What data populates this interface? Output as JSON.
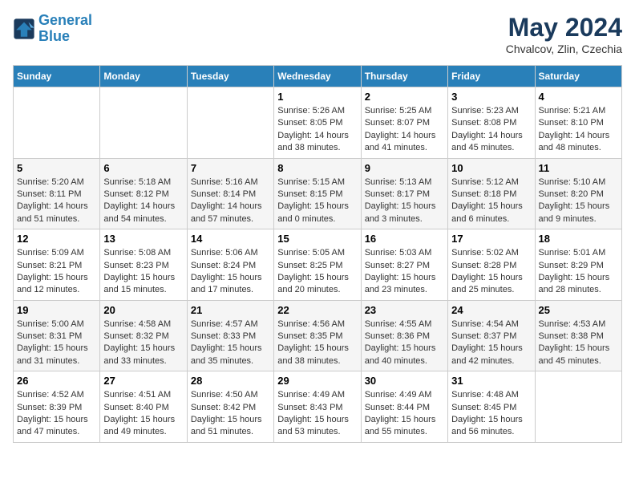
{
  "header": {
    "logo_line1": "General",
    "logo_line2": "Blue",
    "month_title": "May 2024",
    "location": "Chvalcov, Zlin, Czechia"
  },
  "weekdays": [
    "Sunday",
    "Monday",
    "Tuesday",
    "Wednesday",
    "Thursday",
    "Friday",
    "Saturday"
  ],
  "weeks": [
    [
      {
        "day": "",
        "content": ""
      },
      {
        "day": "",
        "content": ""
      },
      {
        "day": "",
        "content": ""
      },
      {
        "day": "1",
        "content": "Sunrise: 5:26 AM\nSunset: 8:05 PM\nDaylight: 14 hours and 38 minutes."
      },
      {
        "day": "2",
        "content": "Sunrise: 5:25 AM\nSunset: 8:07 PM\nDaylight: 14 hours and 41 minutes."
      },
      {
        "day": "3",
        "content": "Sunrise: 5:23 AM\nSunset: 8:08 PM\nDaylight: 14 hours and 45 minutes."
      },
      {
        "day": "4",
        "content": "Sunrise: 5:21 AM\nSunset: 8:10 PM\nDaylight: 14 hours and 48 minutes."
      }
    ],
    [
      {
        "day": "5",
        "content": "Sunrise: 5:20 AM\nSunset: 8:11 PM\nDaylight: 14 hours and 51 minutes."
      },
      {
        "day": "6",
        "content": "Sunrise: 5:18 AM\nSunset: 8:12 PM\nDaylight: 14 hours and 54 minutes."
      },
      {
        "day": "7",
        "content": "Sunrise: 5:16 AM\nSunset: 8:14 PM\nDaylight: 14 hours and 57 minutes."
      },
      {
        "day": "8",
        "content": "Sunrise: 5:15 AM\nSunset: 8:15 PM\nDaylight: 15 hours and 0 minutes."
      },
      {
        "day": "9",
        "content": "Sunrise: 5:13 AM\nSunset: 8:17 PM\nDaylight: 15 hours and 3 minutes."
      },
      {
        "day": "10",
        "content": "Sunrise: 5:12 AM\nSunset: 8:18 PM\nDaylight: 15 hours and 6 minutes."
      },
      {
        "day": "11",
        "content": "Sunrise: 5:10 AM\nSunset: 8:20 PM\nDaylight: 15 hours and 9 minutes."
      }
    ],
    [
      {
        "day": "12",
        "content": "Sunrise: 5:09 AM\nSunset: 8:21 PM\nDaylight: 15 hours and 12 minutes."
      },
      {
        "day": "13",
        "content": "Sunrise: 5:08 AM\nSunset: 8:23 PM\nDaylight: 15 hours and 15 minutes."
      },
      {
        "day": "14",
        "content": "Sunrise: 5:06 AM\nSunset: 8:24 PM\nDaylight: 15 hours and 17 minutes."
      },
      {
        "day": "15",
        "content": "Sunrise: 5:05 AM\nSunset: 8:25 PM\nDaylight: 15 hours and 20 minutes."
      },
      {
        "day": "16",
        "content": "Sunrise: 5:03 AM\nSunset: 8:27 PM\nDaylight: 15 hours and 23 minutes."
      },
      {
        "day": "17",
        "content": "Sunrise: 5:02 AM\nSunset: 8:28 PM\nDaylight: 15 hours and 25 minutes."
      },
      {
        "day": "18",
        "content": "Sunrise: 5:01 AM\nSunset: 8:29 PM\nDaylight: 15 hours and 28 minutes."
      }
    ],
    [
      {
        "day": "19",
        "content": "Sunrise: 5:00 AM\nSunset: 8:31 PM\nDaylight: 15 hours and 31 minutes."
      },
      {
        "day": "20",
        "content": "Sunrise: 4:58 AM\nSunset: 8:32 PM\nDaylight: 15 hours and 33 minutes."
      },
      {
        "day": "21",
        "content": "Sunrise: 4:57 AM\nSunset: 8:33 PM\nDaylight: 15 hours and 35 minutes."
      },
      {
        "day": "22",
        "content": "Sunrise: 4:56 AM\nSunset: 8:35 PM\nDaylight: 15 hours and 38 minutes."
      },
      {
        "day": "23",
        "content": "Sunrise: 4:55 AM\nSunset: 8:36 PM\nDaylight: 15 hours and 40 minutes."
      },
      {
        "day": "24",
        "content": "Sunrise: 4:54 AM\nSunset: 8:37 PM\nDaylight: 15 hours and 42 minutes."
      },
      {
        "day": "25",
        "content": "Sunrise: 4:53 AM\nSunset: 8:38 PM\nDaylight: 15 hours and 45 minutes."
      }
    ],
    [
      {
        "day": "26",
        "content": "Sunrise: 4:52 AM\nSunset: 8:39 PM\nDaylight: 15 hours and 47 minutes."
      },
      {
        "day": "27",
        "content": "Sunrise: 4:51 AM\nSunset: 8:40 PM\nDaylight: 15 hours and 49 minutes."
      },
      {
        "day": "28",
        "content": "Sunrise: 4:50 AM\nSunset: 8:42 PM\nDaylight: 15 hours and 51 minutes."
      },
      {
        "day": "29",
        "content": "Sunrise: 4:49 AM\nSunset: 8:43 PM\nDaylight: 15 hours and 53 minutes."
      },
      {
        "day": "30",
        "content": "Sunrise: 4:49 AM\nSunset: 8:44 PM\nDaylight: 15 hours and 55 minutes."
      },
      {
        "day": "31",
        "content": "Sunrise: 4:48 AM\nSunset: 8:45 PM\nDaylight: 15 hours and 56 minutes."
      },
      {
        "day": "",
        "content": ""
      }
    ]
  ]
}
